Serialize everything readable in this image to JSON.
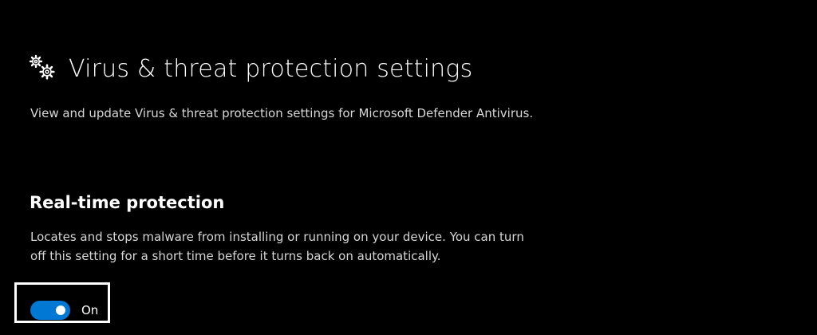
{
  "header": {
    "icon": "gear-icon",
    "title": "Virus & threat protection settings",
    "description": "View and update Virus & threat protection settings for Microsoft Defender Antivirus."
  },
  "real_time_protection": {
    "title": "Real-time protection",
    "description": "Locates and stops malware from installing or running on your device. You can turn off this setting for a short time before it turns back on automatically.",
    "toggle": {
      "state": "on",
      "label": "On",
      "accent_color": "#0078d4"
    }
  },
  "colors": {
    "background": "#000000",
    "focus_outline": "#ffffff"
  }
}
